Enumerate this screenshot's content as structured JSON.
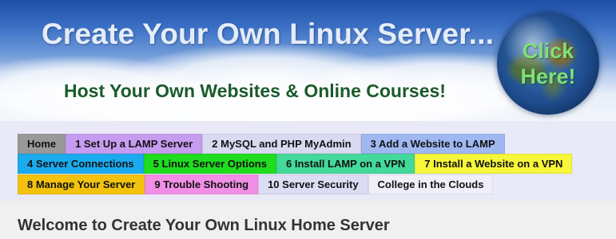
{
  "banner": {
    "title": "Create Your Own Linux Server...",
    "subtitle": "Host Your Own Websites & Online Courses!",
    "click_label": "Click Here!"
  },
  "nav": {
    "row1": [
      {
        "label": "Home",
        "color": "#999999"
      },
      {
        "label": "1 Set Up a LAMP Server",
        "color": "#c79cf0"
      },
      {
        "label": "2 MySQL and PHP MyAdmin",
        "color": "#d9d9f2"
      },
      {
        "label": "3 Add a Website to LAMP",
        "color": "#9fb8f2"
      }
    ],
    "row2": [
      {
        "label": "4 Server Connections",
        "color": "#1aabee"
      },
      {
        "label": "5 Linux Server Options",
        "color": "#1fdc1f"
      },
      {
        "label": "6 Install LAMP on a VPN",
        "color": "#43d99a"
      },
      {
        "label": "7 Install a Website on a VPN",
        "color": "#f6f63a"
      }
    ],
    "row3": [
      {
        "label": "8 Manage Your Server",
        "color": "#f2c20f"
      },
      {
        "label": "9 Trouble Shooting",
        "color": "#f28ee6"
      },
      {
        "label": "10 Server Security",
        "color": "#dcdcf4"
      },
      {
        "label": "College in the Clouds",
        "color": "#efeff9"
      }
    ]
  },
  "main": {
    "heading": "Welcome to Create Your Own Linux Home Server"
  }
}
